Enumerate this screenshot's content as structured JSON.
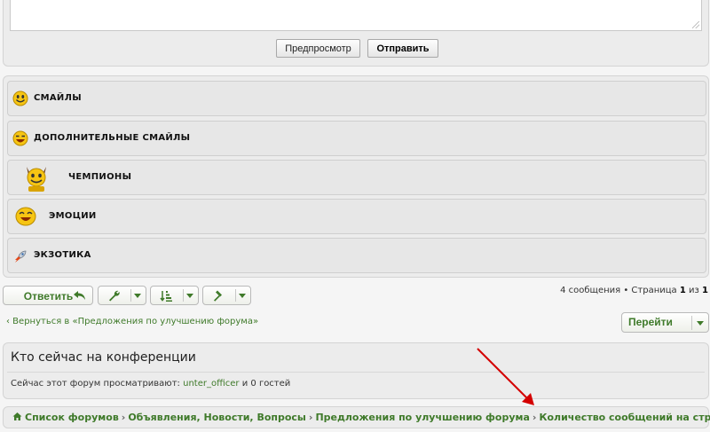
{
  "editor": {
    "preview_label": "Предпросмотр",
    "submit_label": "Отправить"
  },
  "smilies": {
    "sections": [
      {
        "label": "Смайлы",
        "icon": "smiley-face-icon"
      },
      {
        "label": "Дополнительные смайлы",
        "icon": "laughing-smiley-icon"
      },
      {
        "label": "Чемпионы",
        "icon": "horned-champion-smiley-icon"
      },
      {
        "label": "Эмоции",
        "icon": "laughing-smiley-icon"
      },
      {
        "label": "Экзотика",
        "icon": "rocket-icon"
      }
    ]
  },
  "actions": {
    "reply_label": "Ответить",
    "tools_icon": "wrench-icon",
    "sort_icon": "sort-icon",
    "mod_icon": "hammer-icon"
  },
  "pagination": {
    "prefix": "4 сообщения • Страница",
    "current": "1",
    "of": "из",
    "total": "1"
  },
  "navigation": {
    "back_link": "‹ Вернуться в «Предложения по улучшению форума»",
    "jump_label": "Перейти"
  },
  "online": {
    "title": "Кто сейчас на конференции",
    "text_prefix": "Сейчас этот форум просматривают:",
    "user": "unter_officer",
    "text_suffix": "и 0 гостей"
  },
  "breadcrumb": {
    "items": [
      "Список форумов",
      "Объявления, Новости, Вопросы",
      "Предложения по улучшению форума",
      "Количество сообщений на странице"
    ],
    "separator": "›"
  },
  "colors": {
    "accent_green": "#3f7a2a",
    "annotation_red": "#d40000"
  }
}
